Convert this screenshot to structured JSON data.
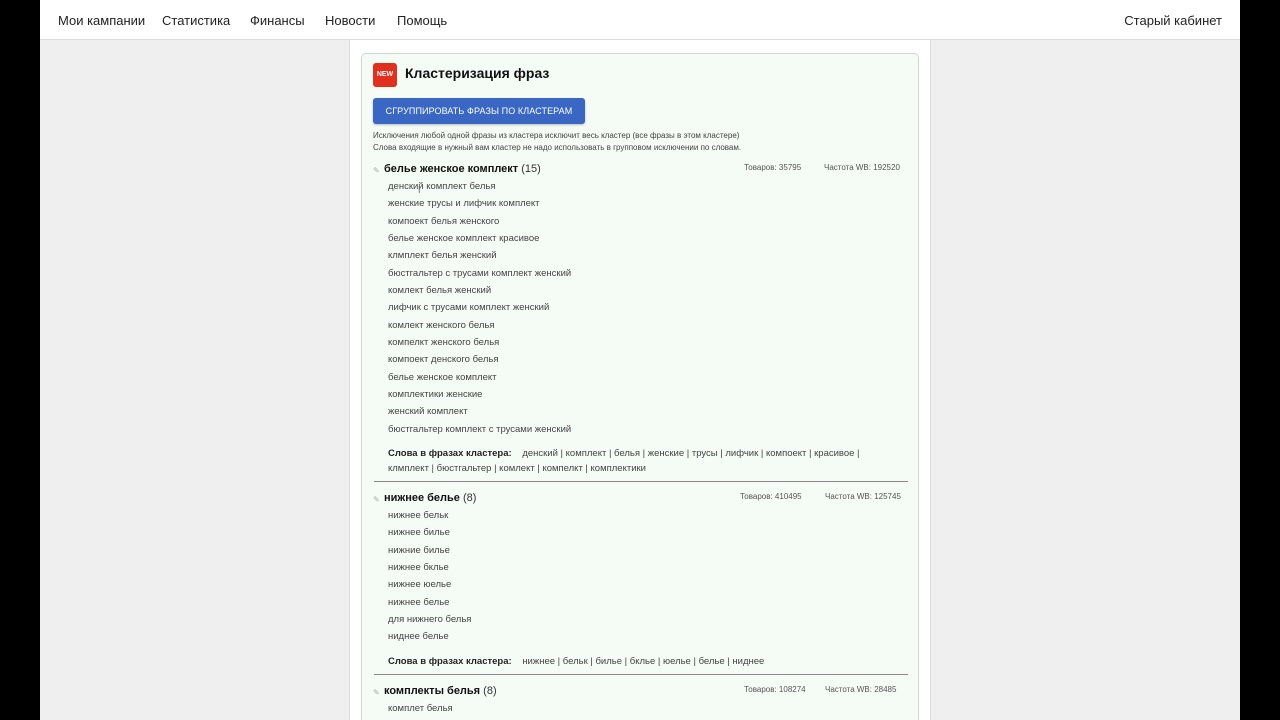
{
  "nav": {
    "items": [
      "Мои кампании",
      "Статистика",
      "Финансы",
      "Новости",
      "Помощь"
    ],
    "right": "Старый кабинет"
  },
  "card": {
    "badge": "NEW",
    "title": "Кластеризация фраз",
    "button_label": "СГРУППИРОВАТЬ ФРАЗЫ ПО КЛАСТЕРАМ",
    "notes": [
      "Исключения любой одной фразы из кластера исключит весь кластер (все фразы в этом кластере)",
      "Слова входящие в нужный вам кластер не надо использовать в групповом исключении по словам."
    ]
  },
  "clusters": [
    {
      "name": "белье женское комплект",
      "count": "(15)",
      "goods": "Товаров: 35795",
      "freq": "Частота WB: 192520",
      "phrases": [
        "денский комплект белья",
        "женские трусы и лифчик комплект",
        "компоект белья женского",
        "белье женское комплект красивое",
        "клмплект белья женский",
        "бюстгальтер с трусами комплект женский",
        "комлект белья женский",
        "лифчик с трусами комплект женский",
        "комлект женского белья",
        "компелкт женского белья",
        "компоект денского белья",
        "белье женское комплект",
        "комплектики женские",
        "женский комплект",
        "бюстгальтер комплект с трусами женский"
      ],
      "words_label": "Слова в фразах кластера:",
      "words": "денский | комплект | белья | женские | трусы | лифчик | компоект | красивое | клмплект | бюстгальтер | комлект | компелкт | комплектики"
    },
    {
      "name": "нижнее белье",
      "count": "(8)",
      "goods": "Товаров: 410495",
      "freq": "Частота WB: 125745",
      "phrases": [
        "нижнее бельк",
        "нижнее билье",
        "нижние билье",
        "нижнее бкльe",
        "нижнее юелье",
        "нижнее белье",
        "для нижнего белья",
        "ниднее белье"
      ],
      "words_label": "Слова в фразах кластера:",
      "words": "нижнее | бельк | билье | бклье | юелье | белье | ниднее"
    },
    {
      "name": "комплекты белья",
      "count": "(8)",
      "goods": "Товаров: 108274",
      "freq": "Частота WB: 28485",
      "phrases": [
        "комплет белья"
      ]
    }
  ]
}
